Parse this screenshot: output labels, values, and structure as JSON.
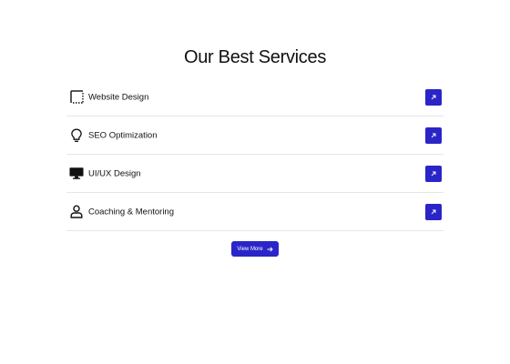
{
  "heading": "Our Best Services",
  "services": [
    {
      "label": "Website Design",
      "icon": "website-design-icon"
    },
    {
      "label": "SEO Optimization",
      "icon": "lightbulb-icon"
    },
    {
      "label": "UI/UX Design",
      "icon": "monitor-icon"
    },
    {
      "label": "Coaching & Mentoring",
      "icon": "person-icon"
    }
  ],
  "view_more_label": "View More",
  "colors": {
    "accent": "#2b25c8",
    "divider": "#e6e6e6",
    "text": "#111111"
  }
}
